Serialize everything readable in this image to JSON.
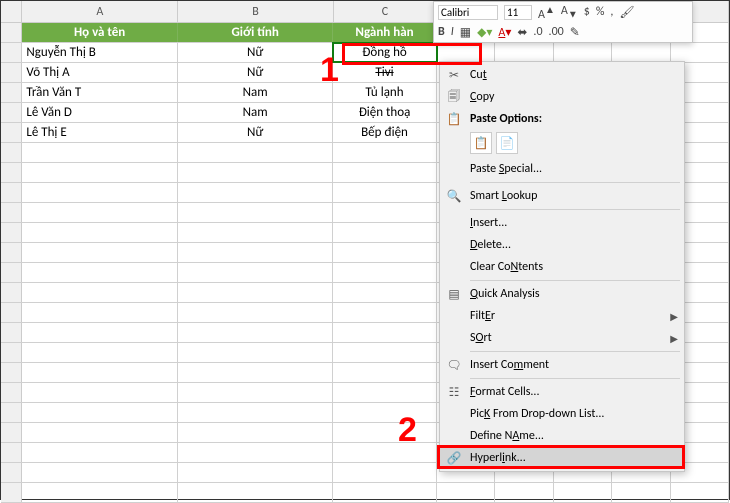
{
  "columns": {
    "a": "A",
    "b": "B",
    "c": "C"
  },
  "headers": {
    "name": "Họ và tên",
    "gender": "Giới tính",
    "prod": "Ngành hàn"
  },
  "rows": [
    {
      "name": "Nguyễn Thị B",
      "gender": "Nữ",
      "prod": "Đồng hồ"
    },
    {
      "name": "Võ Thị A",
      "gender": "Nữ",
      "prod": "Tivi"
    },
    {
      "name": "Trần Văn T",
      "gender": "Nam",
      "prod": "Tủ lạnh"
    },
    {
      "name": "Lê Văn D",
      "gender": "Nam",
      "prod": "Điện thoạ"
    },
    {
      "name": "Lê Thị E",
      "gender": "Nữ",
      "prod": "Bếp điện"
    }
  ],
  "callout": {
    "one": "1",
    "two": "2"
  },
  "mini": {
    "font": "Calibri",
    "size": "11",
    "b": "B",
    "i": "I",
    "pct": "%",
    "comma": ",",
    "dec1": ".0",
    "dec2": ".00"
  },
  "ctx": {
    "cut": "Cut",
    "copy": "Copy",
    "paste_opt": "Paste Options:",
    "paste_special": "Paste Special...",
    "smart": "Smart Lookup",
    "insert": "Insert...",
    "delete": "Delete...",
    "clear": "Clear Contents",
    "quick": "Quick Analysis",
    "filter": "Filter",
    "sort": "Sort",
    "comment": "Insert Comment",
    "fmt": "Format Cells...",
    "pick": "Pick From Drop-down List...",
    "defname": "Define Name...",
    "hyper": "Hyperlink..."
  },
  "ctx_u": {
    "cut": "t",
    "copy": "C",
    "paste_special": "S",
    "smart": "L",
    "insert": "I",
    "delete": "D",
    "clear": "N",
    "quick": "Q",
    "filter": "E",
    "sort": "O",
    "comment": "m",
    "fmt": "F",
    "pick": "K",
    "defname": "A",
    "hyper": "i"
  }
}
